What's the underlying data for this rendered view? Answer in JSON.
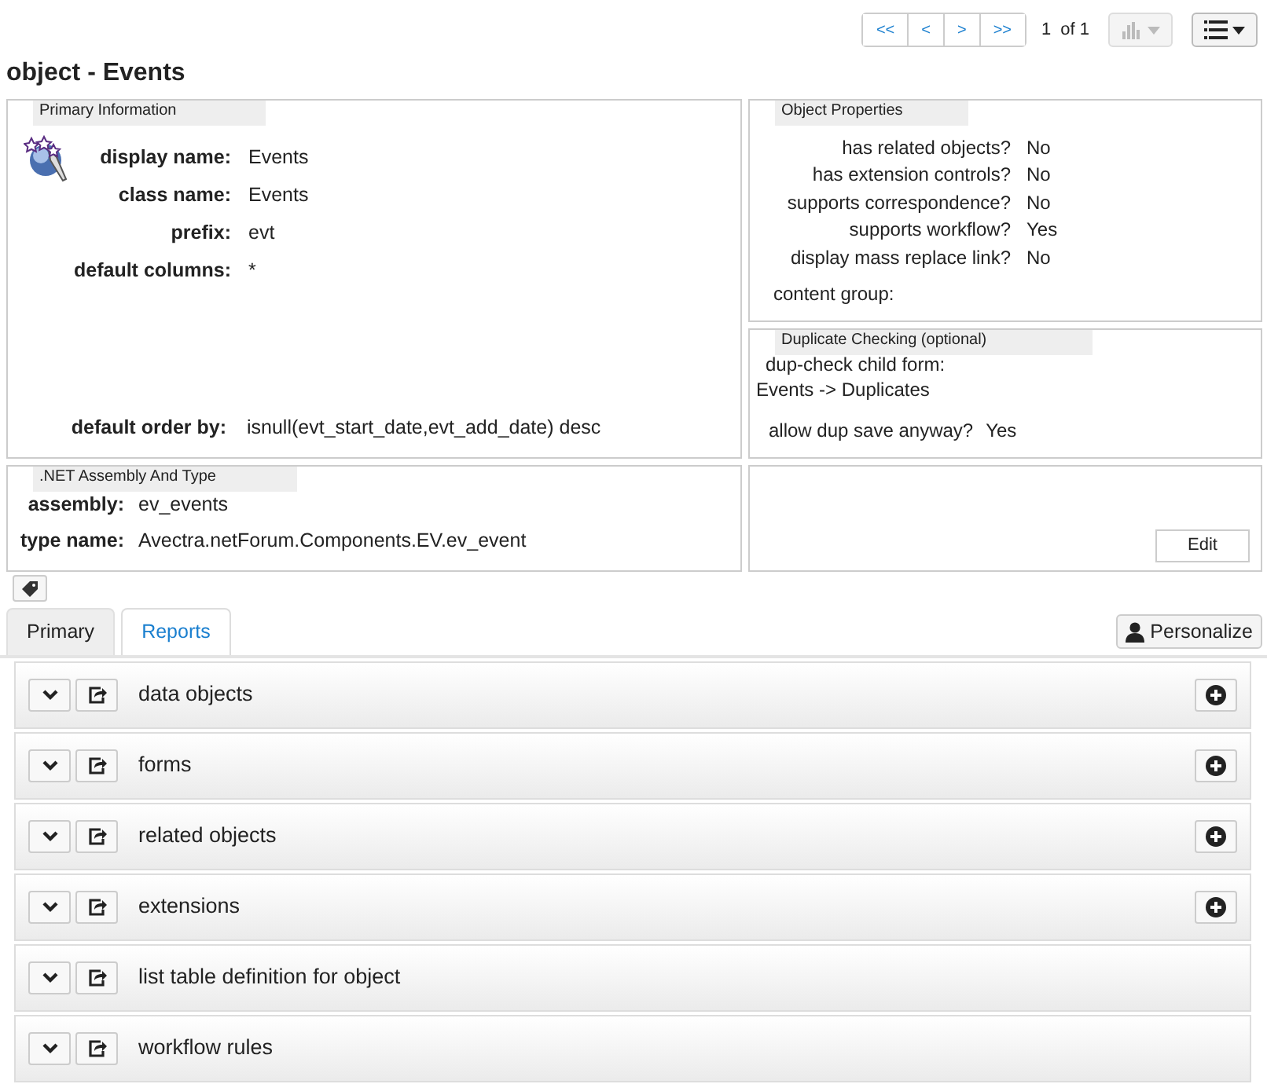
{
  "pager": {
    "buttons": [
      "<<",
      "<",
      ">",
      ">>"
    ],
    "current": "1",
    "of": "of 1"
  },
  "title": "object - Events",
  "primary_information": {
    "legend": "Primary Information",
    "fields": [
      {
        "label": "display name:",
        "value": "Events"
      },
      {
        "label": "class name:",
        "value": "Events"
      },
      {
        "label": "prefix:",
        "value": "evt"
      },
      {
        "label": "default columns:",
        "value": "*"
      }
    ],
    "order_by": {
      "label": "default order by:",
      "value": "isnull(evt_start_date,evt_add_date) desc"
    }
  },
  "object_properties": {
    "legend": "Object Properties",
    "fields": [
      {
        "label": "has related objects?",
        "value": "No"
      },
      {
        "label": "has extension controls?",
        "value": "No"
      },
      {
        "label": "supports correspondence?",
        "value": "No"
      },
      {
        "label": "supports workflow?",
        "value": "Yes"
      },
      {
        "label": "display mass replace link?",
        "value": "No"
      }
    ],
    "content_group": "content group:"
  },
  "duplicate_checking": {
    "legend": "Duplicate Checking (optional)",
    "child_form_label": "dup-check child form:",
    "child_form": "Events -> Duplicates",
    "allow_label": "allow dup save anyway?",
    "allow_value": "Yes"
  },
  "assembly": {
    "legend": ".NET Assembly And Type",
    "fields": [
      {
        "label": "assembly:",
        "value": "ev_events"
      },
      {
        "label": "type name:",
        "value": "Avectra.netForum.Components.EV.ev_event"
      }
    ]
  },
  "edit_button": "Edit",
  "tabs": [
    {
      "label": "Primary",
      "selected": false
    },
    {
      "label": "Reports",
      "selected": true
    }
  ],
  "personalize_button": "Personalize",
  "sections": [
    {
      "title": "data objects",
      "has_add": true
    },
    {
      "title": "forms",
      "has_add": true
    },
    {
      "title": "related objects",
      "has_add": true
    },
    {
      "title": "extensions",
      "has_add": true
    },
    {
      "title": "list table definition for object",
      "has_add": false
    },
    {
      "title": "workflow rules",
      "has_add": false
    }
  ]
}
